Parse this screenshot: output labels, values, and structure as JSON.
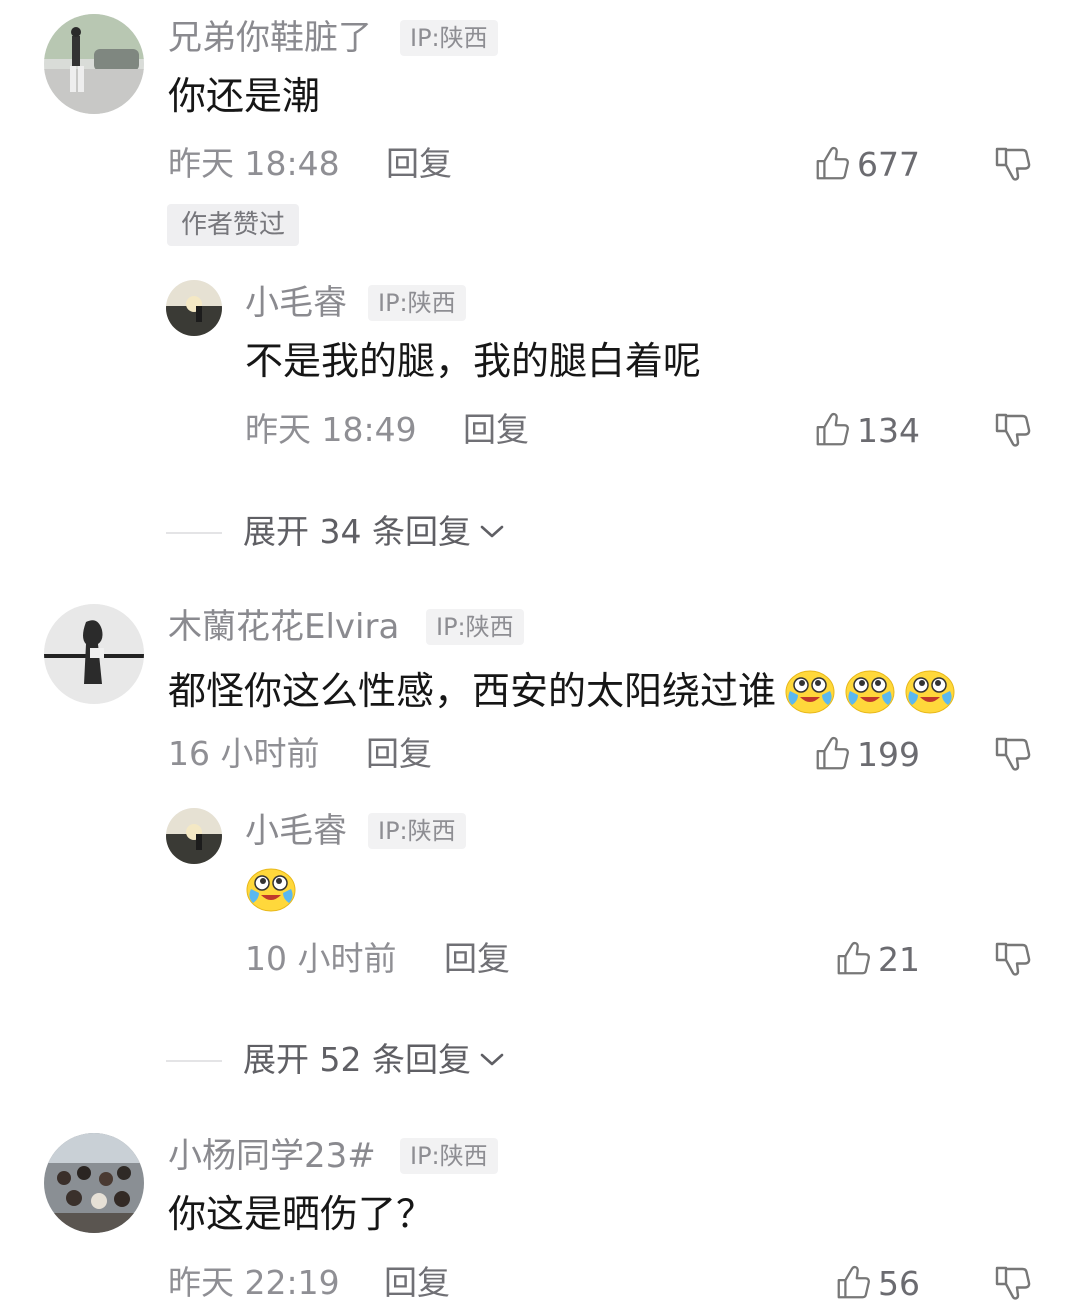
{
  "comments": [
    {
      "username": "兄弟你鞋脏了",
      "ip": "IP:陕西",
      "text": "你还是潮",
      "time": "昨天 18:48",
      "reply_label": "回复",
      "likes": "677",
      "author_badge": "作者赞过",
      "replies": [
        {
          "username": "小毛睿",
          "ip": "IP:陕西",
          "text": "不是我的腿，我的腿白着呢",
          "time": "昨天 18:49",
          "reply_label": "回复",
          "likes": "134"
        }
      ],
      "expand_label": "展开 34 条回复"
    },
    {
      "username": "木蘭花花Elvira",
      "ip": "IP:陕西",
      "text": "都怪你这么性感，西安的太阳绕过谁",
      "text_emojis": [
        "crying-laugh-emoji",
        "crying-laugh-emoji",
        "crying-laugh-emoji"
      ],
      "time": "16 小时前",
      "reply_label": "回复",
      "likes": "199",
      "replies": [
        {
          "username": "小毛睿",
          "ip": "IP:陕西",
          "text_emojis": [
            "crying-laugh-emoji"
          ],
          "time": "10 小时前",
          "reply_label": "回复",
          "likes": "21"
        }
      ],
      "expand_label": "展开 52 条回复"
    },
    {
      "username": "小杨同学23#",
      "ip": "IP:陕西",
      "text": "你这是晒伤了？",
      "time": "昨天 22:19",
      "reply_label": "回复",
      "likes": "56"
    }
  ],
  "icons": {
    "like": "thumbs-up-icon",
    "dislike": "thumbs-down-icon",
    "expand": "chevron-down-icon"
  },
  "colors": {
    "text": "#161616",
    "muted": "#8f8f94",
    "badge_bg": "#f2f2f3"
  }
}
